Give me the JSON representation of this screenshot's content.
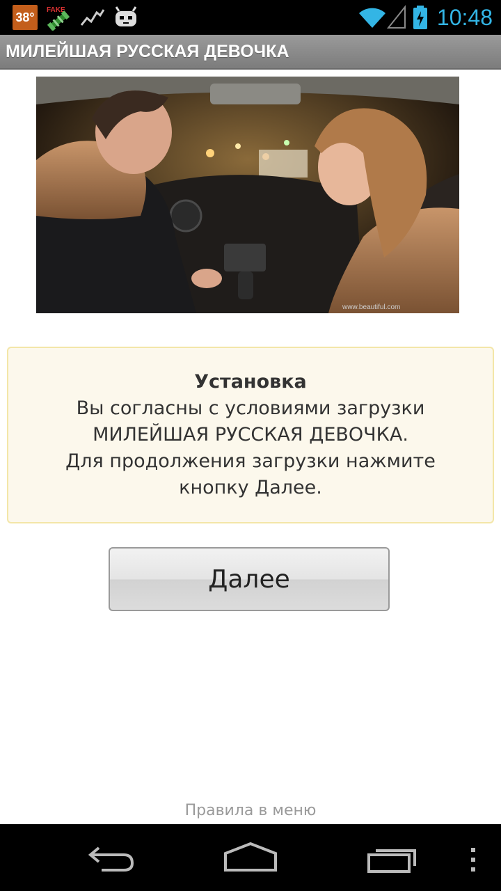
{
  "status_bar": {
    "temperature": "38°",
    "time": "10:48",
    "icons": [
      "weather-temp-icon",
      "fake-gps-icon",
      "activity-graph-icon",
      "android-robot-icon",
      "wifi-icon",
      "signal-icon",
      "battery-charging-icon"
    ]
  },
  "app": {
    "title": "МИЛЕЙШАЯ РУССКАЯ ДЕВОЧКА"
  },
  "info": {
    "heading": "Установка",
    "lines": [
      "Вы согласны с условиями загрузки",
      "МИЛЕЙШАЯ РУССКАЯ ДЕВОЧКА.",
      "Для продолжения загрузки нажмите",
      "кнопку Далее."
    ]
  },
  "actions": {
    "next_label": "Далее"
  },
  "footer": {
    "rules_hint": "Правила в меню"
  },
  "nav_bar": {
    "buttons": [
      "back-icon",
      "home-icon",
      "recents-icon",
      "menu-icon"
    ]
  },
  "colors": {
    "accent": "#33b5e5",
    "title_bar": "#8a8a8a",
    "info_bg": "#fcf8ec",
    "info_border": "#f3e6a8"
  }
}
